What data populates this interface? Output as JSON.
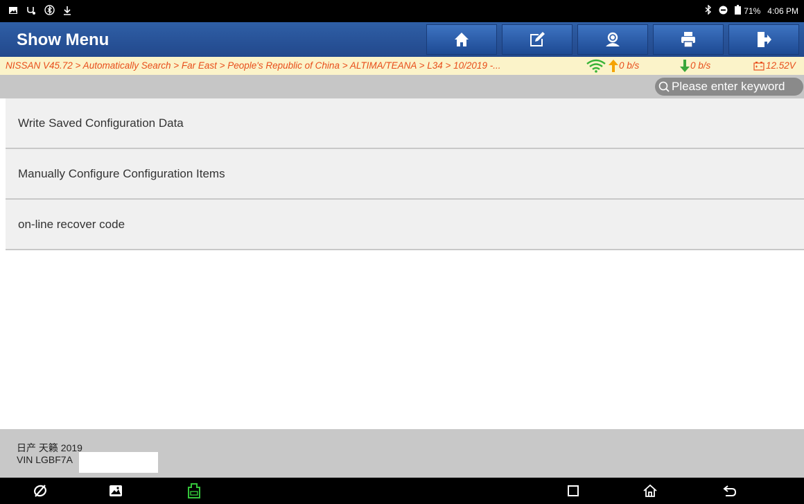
{
  "status_bar": {
    "battery_percent": "71%",
    "time": "4:06 PM"
  },
  "title_bar": {
    "title": "Show Menu",
    "buttons": [
      "home-icon",
      "edit-icon",
      "support-icon",
      "print-icon",
      "exit-icon"
    ]
  },
  "breadcrumb": {
    "path": "NISSAN V45.72 > Automatically Search > Far East > People's Republic of China > ALTIMA/TEANA > L34 > 10/2019 -...",
    "upload_speed": "0 b/s",
    "download_speed": "0 b/s",
    "voltage": "12.52V"
  },
  "search": {
    "placeholder": "Please enter keyword"
  },
  "menu": {
    "items": [
      "Write Saved Configuration Data",
      "Manually Configure Configuration Items",
      "on-line recover code"
    ]
  },
  "footer": {
    "model": "日产 天籁 2019",
    "vin": "VIN LGBF7A"
  },
  "colors": {
    "title_bar": "#2a559c",
    "breadcrumb_bg": "#fbf3c9",
    "breadcrumb_text": "#e84d1a",
    "speed_up": "#f5a300",
    "speed_down": "#3aa63a",
    "vci_green": "#34c43a"
  }
}
